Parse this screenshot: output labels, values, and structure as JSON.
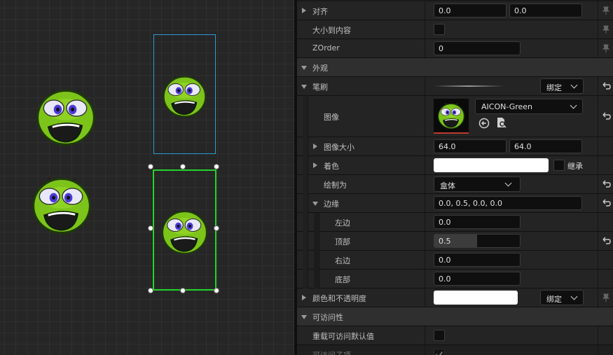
{
  "colors": {
    "panel_bg": "#242424",
    "section_bg": "#2f2f2f",
    "selection_blue": "#2b9bd7",
    "selection_green": "#23d42a",
    "emoji_green": "#8fd01e"
  },
  "canvas": {
    "widgets": [
      {
        "icon": "green-face-icon"
      },
      {
        "icon": "green-face-icon"
      },
      {
        "icon": "green-face-icon"
      },
      {
        "icon": "green-face-icon"
      }
    ]
  },
  "details": {
    "align": {
      "label": "对齐",
      "x": "0.0",
      "y": "0.0"
    },
    "size_to_content": {
      "label": "大小到内容",
      "checked": false
    },
    "zorder": {
      "label": "ZOrder",
      "value": "0"
    },
    "appearance": {
      "label": "外观"
    },
    "brush": {
      "label": "笔刷",
      "bind_label": "绑定"
    },
    "image": {
      "label": "图像",
      "asset": "AICON-Green"
    },
    "image_size": {
      "label": "图像大小",
      "x": "64.0",
      "y": "64.0"
    },
    "tint": {
      "label": "着色",
      "color": "#ffffff",
      "inherit_label": "继承"
    },
    "draw_as": {
      "label": "绘制为",
      "value": "盒体"
    },
    "margin": {
      "label": "边缘",
      "summary": "0.0, 0.5, 0.0, 0.0"
    },
    "margin_left": {
      "label": "左边",
      "value": "0.0"
    },
    "margin_top": {
      "label": "顶部",
      "value": "0.5",
      "fraction": 0.5
    },
    "margin_right": {
      "label": "右边",
      "value": "0.0"
    },
    "margin_bottom": {
      "label": "底部",
      "value": "0.0"
    },
    "color_opacity": {
      "label": "颜色和不透明度",
      "bind_label": "绑定"
    },
    "accessibility": {
      "label": "可访问性"
    },
    "override_access": {
      "label": "重载可访问默认值",
      "checked": false
    },
    "access_children": {
      "label": "可访问子项",
      "checked": true
    }
  }
}
